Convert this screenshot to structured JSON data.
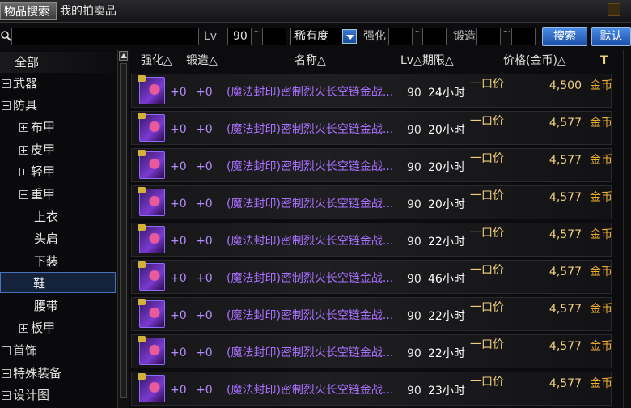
{
  "tabs": [
    {
      "label": "物品搜索",
      "active": true
    },
    {
      "label": "我的拍卖品",
      "active": false
    }
  ],
  "search": {
    "placeholder": "",
    "value": "",
    "lv_label": "Lv",
    "lv_min": "90",
    "lv_max": "",
    "tilde": "~",
    "rarity_selected": "稀有度",
    "strengthen_label": "强化",
    "strengthen_min": "",
    "strengthen_max": "",
    "forge_label": "锻造",
    "forge_min": "",
    "forge_max": "",
    "search_button": "搜索",
    "default_button": "默认"
  },
  "sidebar": {
    "items": [
      {
        "label": "全部",
        "toggle": ""
      },
      {
        "label": "武器",
        "toggle": "plus"
      },
      {
        "label": "防具",
        "toggle": "minus"
      },
      {
        "label": "布甲",
        "toggle": "plus"
      },
      {
        "label": "皮甲",
        "toggle": "plus"
      },
      {
        "label": "轻甲",
        "toggle": "plus"
      },
      {
        "label": "重甲",
        "toggle": "minus"
      },
      {
        "label": "上衣",
        "toggle": ""
      },
      {
        "label": "头肩",
        "toggle": ""
      },
      {
        "label": "下装",
        "toggle": ""
      },
      {
        "label": "鞋",
        "toggle": "",
        "selected": true
      },
      {
        "label": "腰带",
        "toggle": ""
      },
      {
        "label": "板甲",
        "toggle": "plus"
      },
      {
        "label": "首饰",
        "toggle": "plus"
      },
      {
        "label": "特殊装备",
        "toggle": "plus"
      },
      {
        "label": "设计图",
        "toggle": "plus"
      }
    ]
  },
  "table": {
    "headers": {
      "strengthen": "强化△",
      "forge": "锻造△",
      "name": "名称△",
      "lv_period": "Lv△期限△",
      "price": "价格(金币)△",
      "tool": "T"
    },
    "rows": [
      {
        "strengthen": "+0",
        "forge": "+0",
        "name": "(魔法封印)密制烈火长空链金战...",
        "lv": "90",
        "duration": "24小时",
        "price_type": "一口价",
        "price": "4,500",
        "currency": "金币"
      },
      {
        "strengthen": "+0",
        "forge": "+0",
        "name": "(魔法封印)密制烈火长空链金战...",
        "lv": "90",
        "duration": "20小时",
        "price_type": "一口价",
        "price": "4,577",
        "currency": "金币"
      },
      {
        "strengthen": "+0",
        "forge": "+0",
        "name": "(魔法封印)密制烈火长空链金战...",
        "lv": "90",
        "duration": "20小时",
        "price_type": "一口价",
        "price": "4,577",
        "currency": "金币"
      },
      {
        "strengthen": "+0",
        "forge": "+0",
        "name": "(魔法封印)密制烈火长空链金战...",
        "lv": "90",
        "duration": "20小时",
        "price_type": "一口价",
        "price": "4,577",
        "currency": "金币"
      },
      {
        "strengthen": "+0",
        "forge": "+0",
        "name": "(魔法封印)密制烈火长空链金战...",
        "lv": "90",
        "duration": "22小时",
        "price_type": "一口价",
        "price": "4,577",
        "currency": "金币"
      },
      {
        "strengthen": "+0",
        "forge": "+0",
        "name": "(魔法封印)密制烈火长空链金战...",
        "lv": "90",
        "duration": "46小时",
        "price_type": "一口价",
        "price": "4,577",
        "currency": "金币"
      },
      {
        "strengthen": "+0",
        "forge": "+0",
        "name": "(魔法封印)密制烈火长空链金战...",
        "lv": "90",
        "duration": "22小时",
        "price_type": "一口价",
        "price": "4,577",
        "currency": "金币"
      },
      {
        "strengthen": "+0",
        "forge": "+0",
        "name": "(魔法封印)密制烈火长空链金战...",
        "lv": "90",
        "duration": "22小时",
        "price_type": "一口价",
        "price": "4,577",
        "currency": "金币"
      },
      {
        "strengthen": "+0",
        "forge": "+0",
        "name": "(魔法封印)密制烈火长空链金战...",
        "lv": "90",
        "duration": "23小时",
        "price_type": "一口价",
        "price": "4,577",
        "currency": "金币"
      }
    ]
  },
  "colors": {
    "item_name": "#a970ff",
    "price": "#f0d080",
    "accent_blue": "#3a78d0"
  },
  "icons": [
    "search-icon",
    "item-icon",
    "dropdown-arrow-icon",
    "scroll-up-icon",
    "window-icon"
  ]
}
